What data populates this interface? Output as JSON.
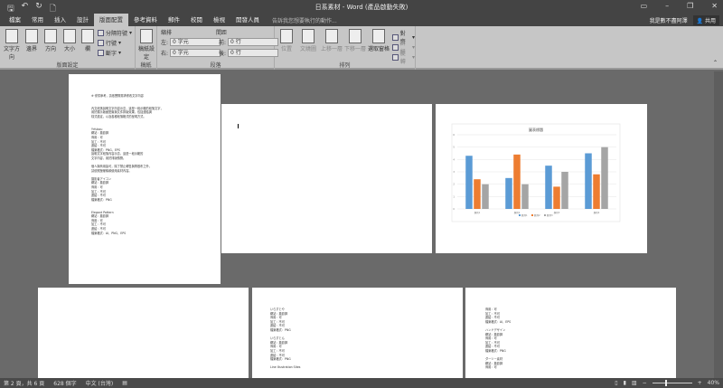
{
  "window": {
    "title": "日系素材 - Word (產品啟動失敗)",
    "user": "我是數不盡阿澤",
    "share": "共用"
  },
  "tabs": [
    "檔案",
    "常用",
    "插入",
    "設計",
    "版面配置",
    "參考資料",
    "郵件",
    "校閱",
    "檢視",
    "開發人員"
  ],
  "active_tab": "版面配置",
  "tell_me": "告訴我您想要執行的動作...",
  "ribbon": {
    "page_setup": {
      "label": "版面設定",
      "text_direction": "文字方向",
      "margins": "邊界",
      "orientation": "方向",
      "size": "大小",
      "columns": "欄",
      "breaks": "分隔符號",
      "line_numbers": "行號",
      "hyphenation": "斷字"
    },
    "manuscript": {
      "label": "稿紙",
      "setup": "稿紙設定"
    },
    "paragraph": {
      "label": "段落",
      "indent": "縮排",
      "spacing": "間距",
      "left_label": "左:",
      "left_value": "0 字元",
      "right_label": "右:",
      "right_value": "0 字元",
      "before_label": "前:",
      "before_value": "0 行",
      "after_label": "後:",
      "after_value": "0 行"
    },
    "arrange": {
      "label": "排列",
      "position": "位置",
      "wrap": "文繞圖",
      "forward": "上移一層",
      "backward": "下移一層",
      "selection_pane": "選取窗格",
      "align": "對齊",
      "group": "群組",
      "rotate": "旋轉"
    }
  },
  "pages": {
    "p1": [
      "※ 僅供參考，請依實際需求修改文字內容",
      "",
      "",
      "內文段落說明文字內容示意，這是一段示範的段落文字，",
      "用於展示版面配置與文件排版效果，包括連結與",
      "樣式設定，以及各種段落格式的呈現方式。",
      "",
      "",
      "Yrfubou",
      "網站：攝影師",
      "商用：可",
      "加工：不可",
      "連結：不可",
      "檔案格式：PNG、EPS",
      "說明文字段落內容示意，這是一段示範的",
      "文字內容，用於排版預覽。",
      "",
      "個人與商用皆可，除了禁止轉售與再散布之外，",
      "請依照授權條款使用素材內容。",
      "",
      "攝影者アイコン",
      "網站：攝影師",
      "商用：可",
      "加工：不可",
      "連結：不可",
      "檔案格式：PNG",
      "",
      "",
      "Elegant Pattern",
      "網站：攝影師",
      "商用：可",
      "加工：不可",
      "連結：不可",
      "檔案格式：AI、PNG、EPS"
    ],
    "p5": [
      "いらすとや",
      "網站：攝影師",
      "商用：可",
      "加工：不可",
      "連結：不可",
      "檔案格式：PNG",
      "",
      "いらすとん",
      "網站：攝影師",
      "商用：可",
      "加工：不可",
      "連結：不可",
      "檔案格式：PNG",
      "",
      "Line Illustration Sites"
    ],
    "p6": [
      "商用：可",
      "加工：不可",
      "連結：不可",
      "檔案格式：AI、EPS",
      "",
      "ハンドデザイン",
      "網站：攝影師",
      "商用：可",
      "加工：不可",
      "連結：不可",
      "檔案格式：PNG",
      "",
      "ダーツー素材",
      "網站：攝影師",
      "商用：可"
    ]
  },
  "chart_data": {
    "type": "bar",
    "title": "圖表標題",
    "categories": [
      "類別1",
      "類別2",
      "類別3",
      "類別4"
    ],
    "series": [
      {
        "name": "數列1",
        "color": "#5b9bd5",
        "values": [
          4.3,
          2.5,
          3.5,
          4.5
        ]
      },
      {
        "name": "數列2",
        "color": "#ed7d31",
        "values": [
          2.4,
          4.4,
          1.8,
          2.8
        ]
      },
      {
        "name": "數列3",
        "color": "#a5a5a5",
        "values": [
          2,
          2,
          3,
          5
        ]
      }
    ],
    "ylim": [
      0,
      6
    ],
    "yticks": [
      0,
      1,
      2,
      3,
      4,
      5,
      6
    ],
    "grid": true,
    "legend": "bottom"
  },
  "status": {
    "page": "第 2 頁，共 6 頁",
    "words": "628 個字",
    "language": "中文 (台灣)",
    "zoom": "40%"
  }
}
